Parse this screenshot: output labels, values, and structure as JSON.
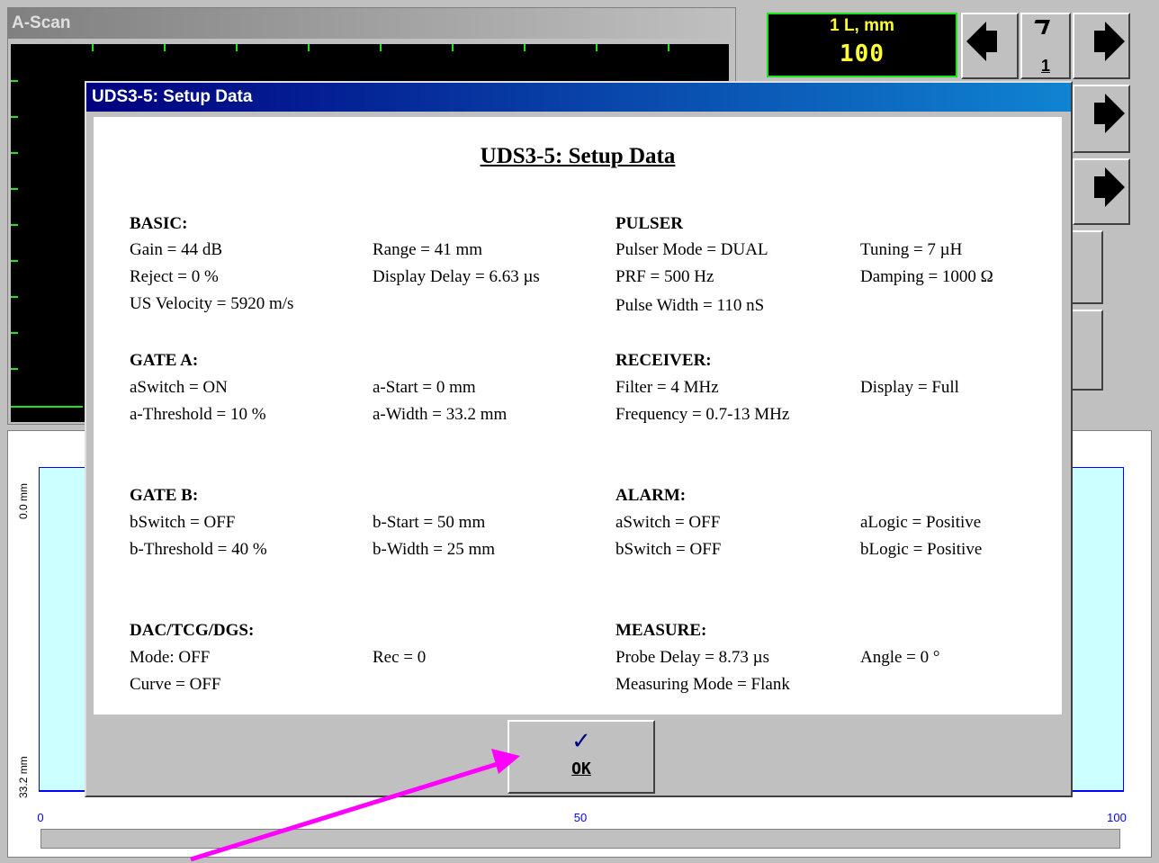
{
  "ascan": {
    "title": "A-Scan"
  },
  "param_box": {
    "label": "1  L, mm",
    "value": "100"
  },
  "step_button": {
    "label": "1"
  },
  "chart": {
    "x_ticks": [
      "0",
      "50",
      "100"
    ],
    "y_ticks": [
      "0.0 mm",
      "33.2 mm"
    ]
  },
  "dialog": {
    "title": "UDS3-5: Setup Data",
    "heading": "UDS3-5: Setup Data",
    "sections": {
      "basic": {
        "title": "BASIC:",
        "gain": "Gain =  44  dB",
        "range": "Range =  41  mm",
        "reject": "Reject =  0  %",
        "display_delay": "Display Delay =  6.63 µs",
        "us_velocity": "US Velocity =  5920  m/s"
      },
      "pulser": {
        "title": "PULSER",
        "pulser_mode": "Pulser Mode = DUAL",
        "tuning": "Tuning = 7 µH",
        "prf": "PRF =  500  Hz",
        "damping": "Damping = 1000 Ω",
        "pulse_width": "Pulse Width = 110 nS"
      },
      "gate_a": {
        "title": "GATE A:",
        "switch": "aSwitch = ON",
        "start": "a-Start =  0  mm",
        "threshold": "a-Threshold =  10  %",
        "width": "a-Width =  33.2  mm"
      },
      "receiver": {
        "title": "RECEIVER:",
        "filter": "Filter = 4 MHz",
        "display": "Display = Full",
        "frequency": "Frequency = 0.7-13 MHz"
      },
      "gate_b": {
        "title": "GATE B:",
        "switch": "bSwitch = OFF",
        "start": "b-Start =  50  mm",
        "threshold": "b-Threshold =  40  %",
        "width": "b-Width =  25  mm"
      },
      "alarm": {
        "title": "ALARM:",
        "a_switch": "aSwitch = OFF",
        "a_logic": "aLogic = Positive",
        "b_switch": "bSwitch = OFF",
        "b_logic": "bLogic = Positive"
      },
      "dac": {
        "title": "DAC/TCG/DGS:",
        "mode": "Mode: OFF",
        "rec": "Rec =  0",
        "curve": "Curve = OFF"
      },
      "measure": {
        "title": "MEASURE:",
        "probe_delay": "Probe Delay =  8.73 µs",
        "angle": "Angle =  0 °",
        "measuring_mode": "Measuring Mode = Flank"
      }
    },
    "ok_icon": "checkmark-icon",
    "ok_label": "OK"
  },
  "colors": {
    "ascan_trace": "#19e619",
    "param_text": "#ffff33",
    "chart_fill": "#ccffff",
    "chart_axis": "#0000ff",
    "titlebar": "#000080",
    "annotation": "#ff00ff"
  }
}
